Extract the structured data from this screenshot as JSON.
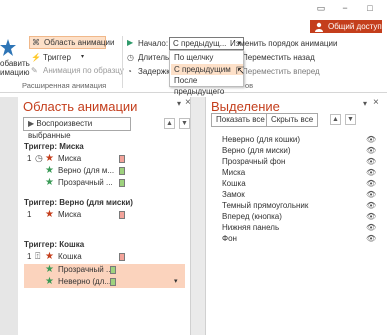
{
  "window": {
    "controls": [
      "▭",
      "−",
      "□"
    ],
    "share_label": "Общий доступ"
  },
  "ribbon": {
    "add_anim_label": "обавить",
    "add_anim_label2": "имацию",
    "anim_pane_label": "Область анимации",
    "trigger_label": "Триггер",
    "anim_painter_label": "Анимация по образцу",
    "group_label": "Расширенная анимация",
    "start_label": "Начало:",
    "start_value": "С предыдущ...",
    "duration_label": "Длитель",
    "delay_label": "Задержка",
    "reorder_label": "Изменить порядок анимации",
    "move_back_label": "Переместить назад",
    "move_forward_label": "Переместить вперед",
    "group2_label": "ов",
    "dropdown_options": [
      "По щелчку",
      "С предыдущим",
      "После предыдущего"
    ]
  },
  "anim_pane": {
    "title": "Область анимации",
    "play_label": "Воспроизвести выбранные",
    "groups": [
      {
        "trigger": "Триггер: Миска",
        "items": [
          {
            "num": "1",
            "text": "Миска",
            "star": "red",
            "bar": "red",
            "highlight": false
          },
          {
            "num": "",
            "text": "Верно (для м...",
            "star": "green",
            "bar": "green",
            "highlight": false
          },
          {
            "num": "",
            "text": "Прозрачный ...",
            "star": "green",
            "bar": "green",
            "highlight": false
          }
        ]
      },
      {
        "trigger": "Триггер: Верно (для миски)",
        "items": [
          {
            "num": "1",
            "text": "Миска",
            "star": "red",
            "bar": "red",
            "highlight": false
          }
        ]
      },
      {
        "trigger": "Триггер: Кошка",
        "items": [
          {
            "num": "1",
            "text": "Кошка",
            "star": "red",
            "bar": "red",
            "highlight": false
          },
          {
            "num": "",
            "text": "Прозрачный ...",
            "star": "green",
            "bar": "green",
            "highlight": true
          },
          {
            "num": "",
            "text": "Неверно (дл...",
            "star": "green",
            "bar": "green",
            "highlight": true
          }
        ]
      }
    ]
  },
  "selection_pane": {
    "title": "Выделение",
    "show_all_label": "Показать все",
    "hide_all_label": "Скрыть все",
    "items": [
      "Неверно (для кошки)",
      "Верно (для миски)",
      "Прозрачный фон",
      "Миска",
      "Кошка",
      "Замок",
      "Темный прямоугольник",
      "Вперед (кнопка)",
      "Нижняя панель",
      "Фон"
    ]
  },
  "colors": {
    "accent": "#c43e1c",
    "highlight": "#fbd3bd",
    "green_star": "#3a9a56"
  }
}
